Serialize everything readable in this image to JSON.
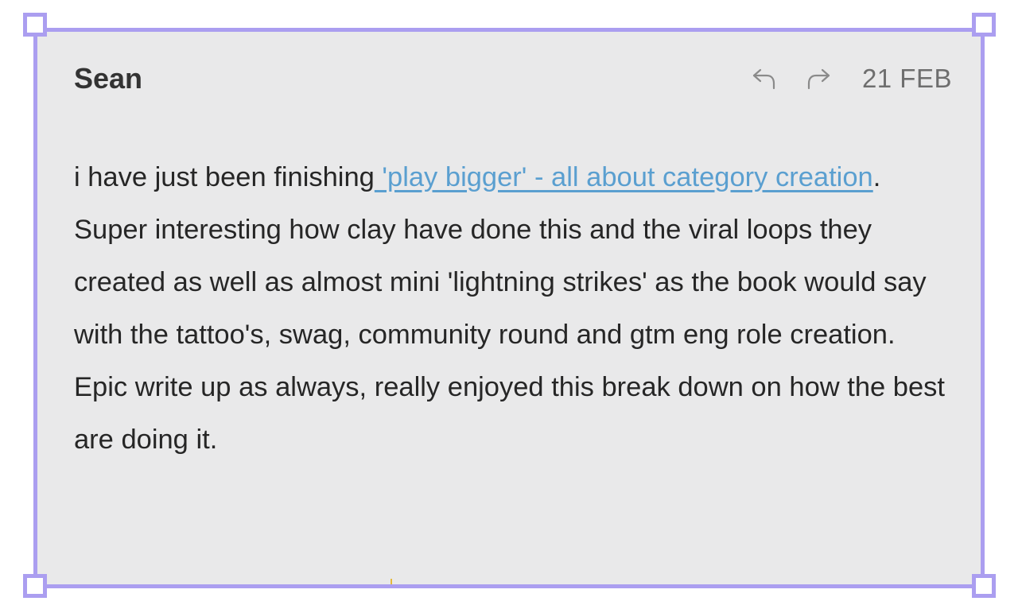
{
  "comment": {
    "author": "Sean",
    "date": "21 FEB",
    "paragraph1_prefix": "i have just been finishing",
    "paragraph1_link": " 'play bigger' - all about category creation",
    "paragraph1_suffix": ".",
    "paragraph2": "Super interesting how clay have done this and the viral loops they created as well as almost mini 'lightning strikes' as the book would say with the tattoo's, swag, community round and gtm eng role creation.",
    "paragraph3": "Epic write up as always, really enjoyed this break down on how the best are doing it."
  },
  "icons": {
    "reply": "reply-arrow-icon",
    "forward": "forward-arrow-icon"
  },
  "colors": {
    "selection_border": "#ab9ef0",
    "card_background": "#e9e9ea",
    "link": "#5a9fd0",
    "text": "#262626",
    "date": "#6e6e6e"
  }
}
